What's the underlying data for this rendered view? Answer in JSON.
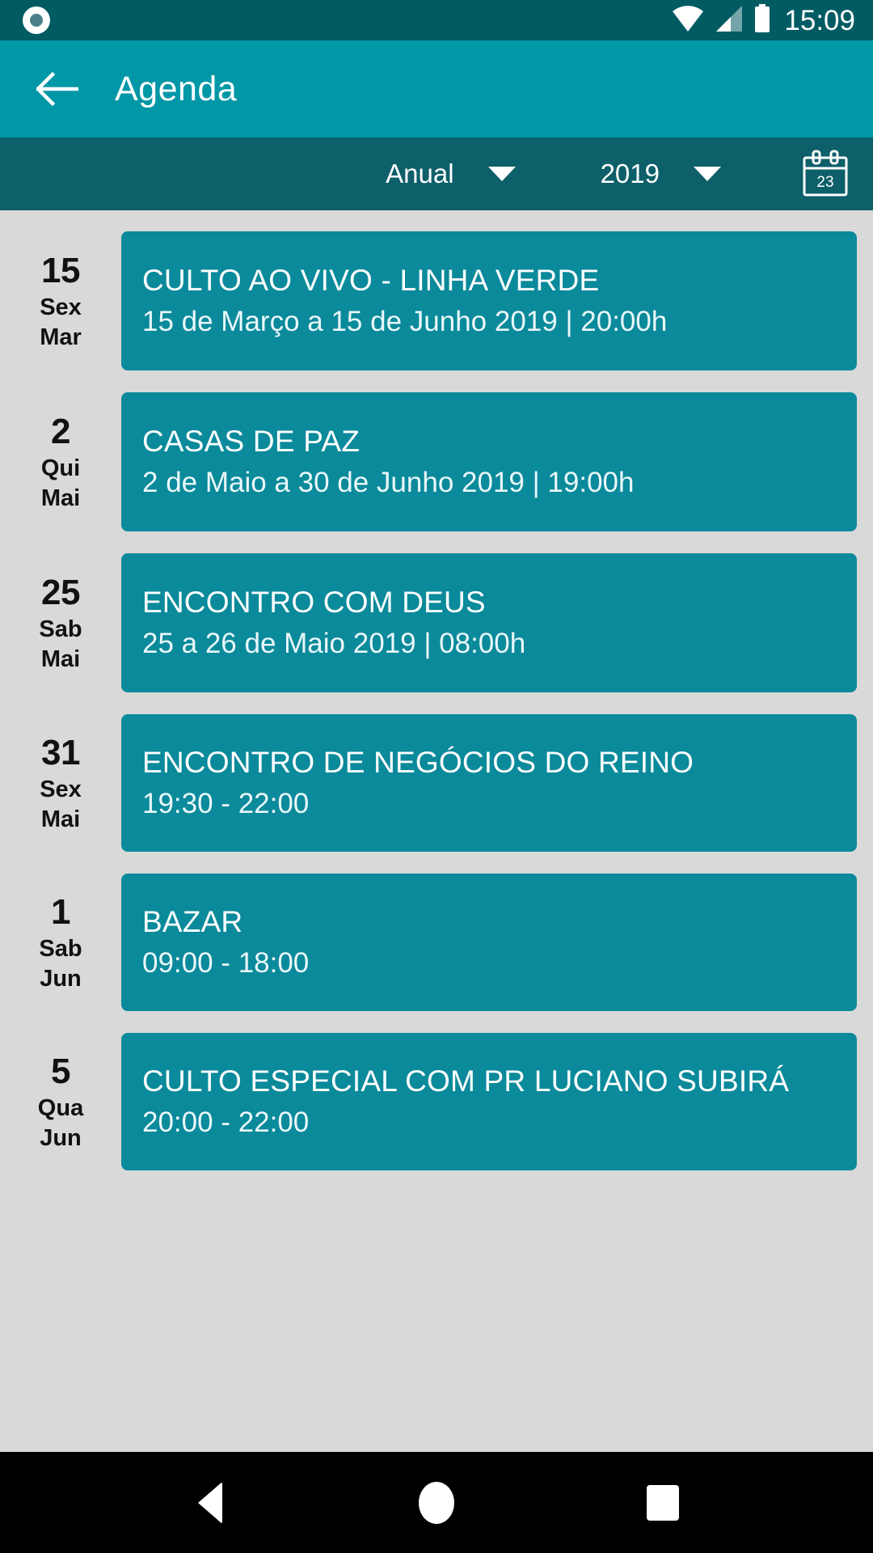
{
  "status_bar": {
    "notification_icon": "record-circle-icon",
    "wifi_icon": "wifi-icon",
    "signal_icon": "cell-signal-icon",
    "battery_icon": "battery-full-icon",
    "clock": "15:09",
    "background_color": "#005b63"
  },
  "app_bar": {
    "back_icon": "arrow-left-icon",
    "title": "Agenda",
    "background_color": "#0097a7"
  },
  "filter_bar": {
    "period_value": "Anual",
    "period_caret": "chevron-down-icon",
    "year_value": "2019",
    "year_caret": "chevron-down-icon",
    "calendar_icon": "calendar-icon",
    "calendar_day": "23",
    "background_color": "#0d5f69"
  },
  "agenda": {
    "card_color": "#0a8a9b",
    "background_color": "#d9d9d9",
    "events": [
      {
        "day": "15",
        "weekday": "Sex",
        "month": "Mar",
        "title": "CULTO AO VIVO - LINHA VERDE",
        "subtitle": "15 de Março a 15 de Junho 2019 | 20:00h"
      },
      {
        "day": "2",
        "weekday": "Qui",
        "month": "Mai",
        "title": "CASAS DE PAZ",
        "subtitle": "2 de Maio a 30 de Junho 2019 | 19:00h"
      },
      {
        "day": "25",
        "weekday": "Sab",
        "month": "Mai",
        "title": "ENCONTRO COM DEUS",
        "subtitle": "25 a 26 de Maio 2019 | 08:00h"
      },
      {
        "day": "31",
        "weekday": "Sex",
        "month": "Mai",
        "title": "ENCONTRO DE NEGÓCIOS DO REINO",
        "subtitle": "19:30 - 22:00"
      },
      {
        "day": "1",
        "weekday": "Sab",
        "month": "Jun",
        "title": "BAZAR",
        "subtitle": "09:00 - 18:00"
      },
      {
        "day": "5",
        "weekday": "Qua",
        "month": "Jun",
        "title": "CULTO ESPECIAL COM PR LUCIANO SUBIRÁ",
        "subtitle": "20:00 - 22:00"
      }
    ]
  },
  "nav_bar": {
    "back_icon": "triangle-back-icon",
    "home_icon": "circle-home-icon",
    "recents_icon": "square-recents-icon",
    "background_color": "#000000"
  }
}
